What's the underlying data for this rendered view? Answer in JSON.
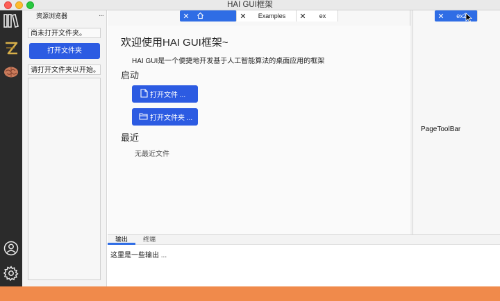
{
  "window": {
    "title": "HAI GUI框架"
  },
  "activity_bar": {
    "icons": [
      "explorer-icon",
      "z-logo-icon",
      "brain-icon",
      "account-icon",
      "settings-icon"
    ]
  },
  "explorer": {
    "header": "资源浏览器",
    "more": "···",
    "no_folder": "尚未打开文件夹。",
    "open_folder_button": "打开文件夹",
    "open_hint": "请打开文件夹以开始。"
  },
  "editor": {
    "left_tabs": [
      {
        "label": "",
        "icon": "home-icon",
        "active": true
      },
      {
        "label": "Examples",
        "active": false
      },
      {
        "label": "ex",
        "active": false
      }
    ],
    "right_tabs": [
      {
        "label": "ex2",
        "active": true
      }
    ],
    "close_glyph": "✕",
    "welcome": {
      "title": "欢迎使用HAI GUI框架~",
      "description": "HAI GUI是一个便捷地开发基于人工智能算法的桌面应用的框架",
      "start_heading": "启动",
      "open_file_button": "打开文件 ...",
      "open_folder_button": "打开文件夹 ...",
      "recent_heading": "最近",
      "no_recent": "无最近文件"
    },
    "right_content": "PageToolBar"
  },
  "bottom_panel": {
    "tabs": [
      {
        "label": "输出",
        "active": true
      },
      {
        "label": "终端",
        "active": false
      }
    ],
    "output_text": "这里是一些输出 ..."
  },
  "colors": {
    "accent": "#2c5be2",
    "tab_active": "#2f6de5",
    "activity_bg": "#2b2b2b",
    "desktop": "#f08a4b"
  }
}
